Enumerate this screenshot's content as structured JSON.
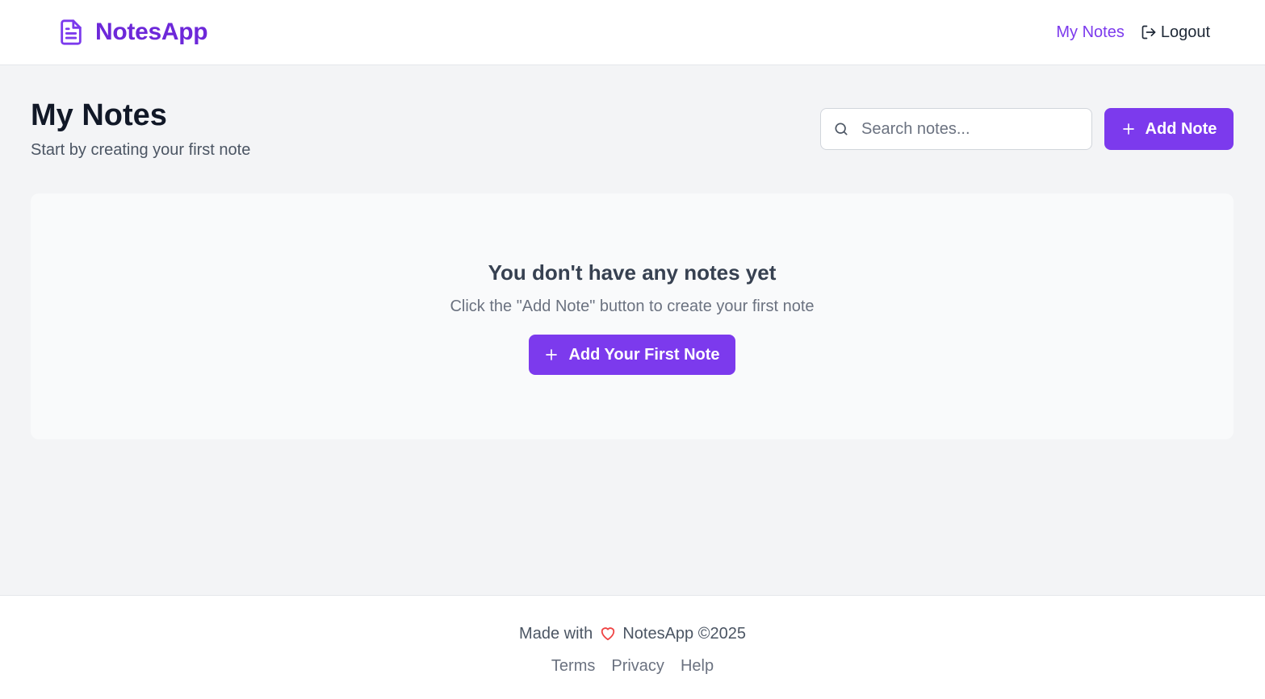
{
  "navbar": {
    "brand": "NotesApp",
    "brand_icon": "document-icon",
    "my_notes_link": "My Notes",
    "logout_label": "Logout",
    "logout_icon": "logout-icon"
  },
  "header": {
    "title": "My Notes",
    "subtitle": "Start by creating your first note"
  },
  "search": {
    "placeholder": "Search notes...",
    "value": ""
  },
  "actions": {
    "add_note_label": "Add Note"
  },
  "empty_state": {
    "title": "You don't have any notes yet",
    "message": "Click the \"Add Note\" button to create your first note",
    "button_label": "Add Your First Note"
  },
  "footer": {
    "made_with": "Made with",
    "copyright": "NotesApp ©2025",
    "links": [
      "Terms",
      "Privacy",
      "Help"
    ]
  },
  "colors": {
    "accent": "#7c3aed",
    "brand": "#6d28d9",
    "heart": "#ef4444"
  }
}
